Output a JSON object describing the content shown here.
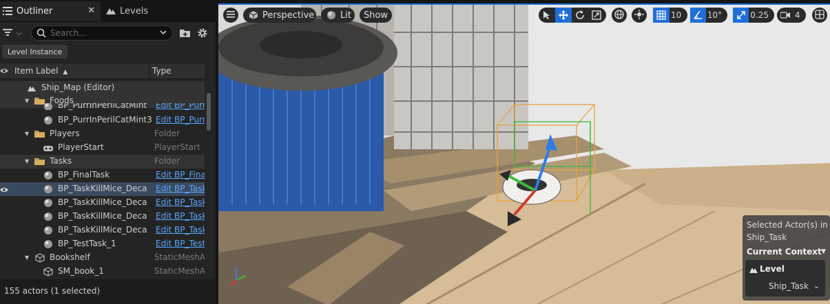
{
  "outliner": {
    "tabs": [
      {
        "label": "Outliner",
        "icon": "outliner-icon"
      },
      {
        "label": "Levels",
        "icon": "levels-icon"
      }
    ],
    "search": {
      "placeholder": "Search..."
    },
    "level_instance_button": "Level Instance",
    "columns": {
      "label": "Item Label",
      "sort": "▲",
      "type": "Type"
    },
    "rows": [
      {
        "label": "Ship_Map (Editor)",
        "type": "",
        "icon": "map-icon",
        "indent": 1,
        "expanded": true
      },
      {
        "label": "Foods",
        "type": "",
        "icon": "folder-icon",
        "indent": 2,
        "expanded": true
      },
      {
        "label": "BP_PurrInPerilCatMint",
        "type": "Edit BP_Purr",
        "icon": "actor-icon",
        "indent": 3,
        "link": true
      },
      {
        "label": "BP_PurrInPerilCatMint3",
        "type": "Edit BP_Purr",
        "icon": "actor-icon",
        "indent": 3,
        "link": true
      },
      {
        "label": "Players",
        "type": "Folder",
        "icon": "folder-icon",
        "indent": 2,
        "expanded": true
      },
      {
        "label": "PlayerStart",
        "type": "PlayerStart",
        "icon": "player-start-icon",
        "indent": 3
      },
      {
        "label": "Tasks",
        "type": "Folder",
        "icon": "folder-icon",
        "indent": 2,
        "expanded": true
      },
      {
        "label": "BP_FinalTask",
        "type": "Edit BP_Final",
        "icon": "actor-icon",
        "indent": 3,
        "link": true
      },
      {
        "label": "BP_TaskKillMice_Deca",
        "type": "Edit BP_Task",
        "icon": "actor-icon",
        "indent": 3,
        "link": true,
        "selected": true
      },
      {
        "label": "BP_TaskKillMice_Deca",
        "type": "Edit BP_Task",
        "icon": "actor-icon",
        "indent": 3,
        "link": true
      },
      {
        "label": "BP_TaskKillMice_Deca",
        "type": "Edit BP_Task",
        "icon": "actor-icon",
        "indent": 3,
        "link": true
      },
      {
        "label": "BP_TaskKillMice_Deca",
        "type": "Edit BP_Task",
        "icon": "actor-icon",
        "indent": 3,
        "link": true
      },
      {
        "label": "BP_TestTask_1",
        "type": "Edit BP_Test",
        "icon": "actor-icon",
        "indent": 3,
        "link": true
      },
      {
        "label": "Bookshelf",
        "type": "StaticMeshA",
        "icon": "static-mesh-icon",
        "indent": 2,
        "expanded": true
      },
      {
        "label": "SM_book_1",
        "type": "StaticMeshA",
        "icon": "static-mesh-icon",
        "indent": 3
      }
    ],
    "status": "155 actors (1 selected)"
  },
  "viewport": {
    "perspective_label": "Perspective",
    "lit_label": "Lit",
    "show_label": "Show",
    "grid_snap_value": "10",
    "rotation_snap_value": "10°",
    "scale_snap_value": "0.25",
    "camera_speed_value": "4",
    "context": {
      "selected_text": "Selected Actor(s) in Ship_Task",
      "current_context": "Current Context",
      "level_label": "Level",
      "level_value": "Ship_Task"
    },
    "axis_colors": {
      "x": "#d33a2a",
      "y": "#3bbf3b",
      "z": "#2f7ce8"
    },
    "accent_color": "#1f6fd9"
  }
}
